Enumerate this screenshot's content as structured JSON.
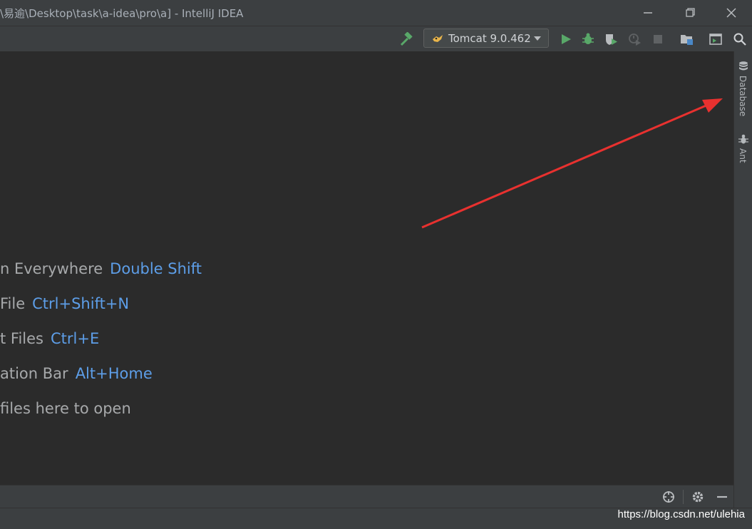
{
  "window": {
    "title": "\\易逾\\Desktop\\task\\a-idea\\pro\\a] - IntelliJ IDEA"
  },
  "toolbar": {
    "run_config_label": "Tomcat 9.0.462"
  },
  "editor": {
    "hints": [
      {
        "text": "n Everywhere",
        "shortcut": "Double Shift"
      },
      {
        "text": " File",
        "shortcut": "Ctrl+Shift+N"
      },
      {
        "text": "t Files",
        "shortcut": "Ctrl+E"
      },
      {
        "text": "ation Bar",
        "shortcut": "Alt+Home"
      },
      {
        "text": "files here to open",
        "shortcut": ""
      }
    ]
  },
  "right_stripe": {
    "tabs": [
      {
        "label": "Database",
        "icon": "database-icon"
      },
      {
        "label": "Ant",
        "icon": "ant-icon"
      }
    ]
  },
  "watermark": {
    "text": "https://blog.csdn.net/ulehia"
  },
  "colors": {
    "accent_link": "#5d9ee8",
    "run_green": "#59a869",
    "annotation_red": "#e8312f"
  }
}
